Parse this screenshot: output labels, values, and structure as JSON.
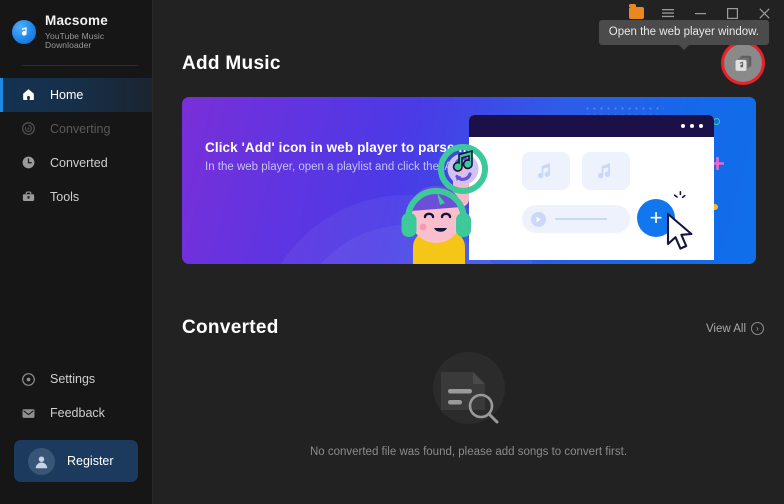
{
  "app": {
    "brand_name": "Macsome",
    "brand_subtitle": "YouTube Music Downloader",
    "accent_blue": "#1e88e5",
    "highlight_red": "#ec2027",
    "sidebar_bg": "#161616",
    "main_bg": "#222222"
  },
  "titlebar": {
    "folder_label": "Open output folder",
    "menu_label": "Menu",
    "minimize_label": "–",
    "maximize_label": "☐",
    "close_label": "✕",
    "tooltip": "Open the web player window."
  },
  "sidebar": {
    "items": [
      {
        "label": "Home",
        "icon": "home-icon",
        "state": "active"
      },
      {
        "label": "Converting",
        "icon": "converting-icon",
        "state": "disabled"
      },
      {
        "label": "Converted",
        "icon": "clock-icon",
        "state": "normal"
      },
      {
        "label": "Tools",
        "icon": "toolbox-icon",
        "state": "normal"
      }
    ],
    "bottom_items": [
      {
        "label": "Settings",
        "icon": "gear-icon"
      },
      {
        "label": "Feedback",
        "icon": "feedback-icon"
      }
    ],
    "register": {
      "label": "Register",
      "icon": "user-avatar-icon"
    }
  },
  "main": {
    "add_music": {
      "title": "Add Music",
      "webplayer_button_icon": "music-library-icon",
      "banner": {
        "headline": "Click 'Add' icon in web player to parse music",
        "subtext": "In the web player, open a playlist and click the 'Add' button",
        "plus_button_label": "+"
      }
    },
    "converted": {
      "title": "Converted",
      "view_all_label": "View All",
      "view_all_icon": "chevron-right-circle-icon",
      "empty_illustration": "document-search-icon",
      "empty_text": "No converted file was found, please add songs to convert first."
    }
  }
}
